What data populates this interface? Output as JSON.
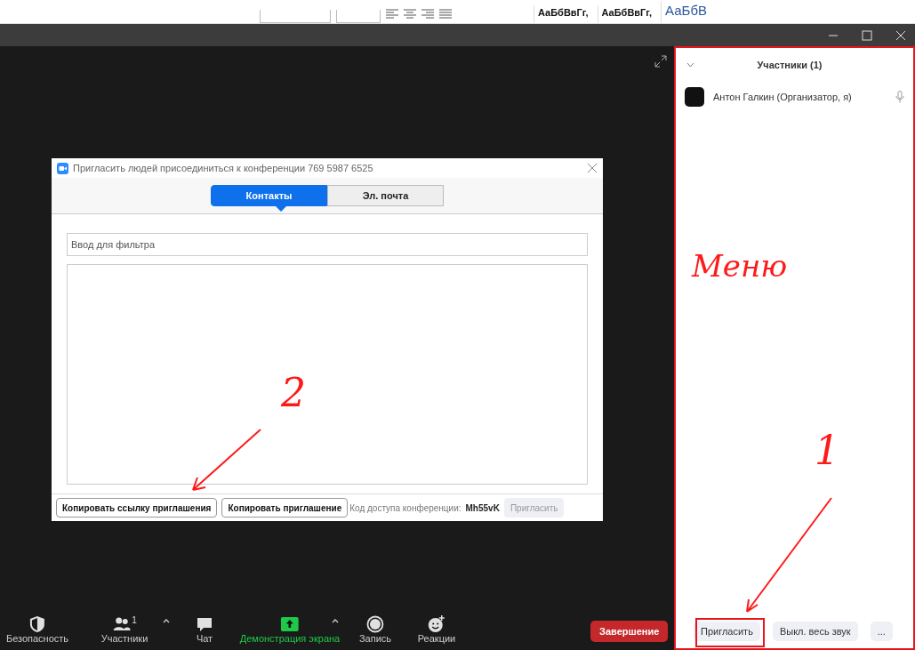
{
  "ribbon": {
    "styles": [
      "АаБбВвГг,",
      "АаБбВвГг,",
      "АаБбВ"
    ]
  },
  "dialog": {
    "title": "Пригласить людей присоединиться к конференции 769 5987 6525",
    "tabs": [
      {
        "label": "Контакты",
        "selected": true
      },
      {
        "label": "Эл. почта",
        "selected": false
      }
    ],
    "filter": {
      "placeholder": "Ввод для фильтра"
    },
    "buttons": [
      "Копировать ссылку приглашения",
      "Копировать приглашение"
    ],
    "passcode_label": "Код доступа конференции:",
    "passcode": "Mh55vK",
    "invite_button": {
      "label": "Пригласить",
      "disabled": true
    }
  },
  "toolbar": {
    "items": [
      {
        "kind": "shield",
        "label": "Безопасность",
        "highlighted": false
      },
      {
        "kind": "people",
        "label": "Участники",
        "badge": "1",
        "caret": true,
        "highlighted": false
      },
      {
        "kind": "chat",
        "label": "Чат",
        "highlighted": false
      },
      {
        "kind": "share",
        "label": "Демонстрация экрана",
        "caret": true,
        "highlighted": true
      },
      {
        "kind": "record",
        "label": "Запись",
        "highlighted": false
      },
      {
        "kind": "reaction",
        "label": "Реакции",
        "highlighted": false
      }
    ],
    "end_button": "Завершение"
  },
  "panel": {
    "title": "Участники (1)",
    "participants": [
      {
        "name": "Антон Галкин (Организатор, я)"
      }
    ],
    "buttons": [
      "Пригласить",
      "Выкл. весь звук",
      "..."
    ]
  },
  "annotations": [
    {
      "kind": "label",
      "text": "Меню"
    },
    {
      "kind": "number",
      "text": "2"
    },
    {
      "kind": "number",
      "text": "1"
    }
  ]
}
